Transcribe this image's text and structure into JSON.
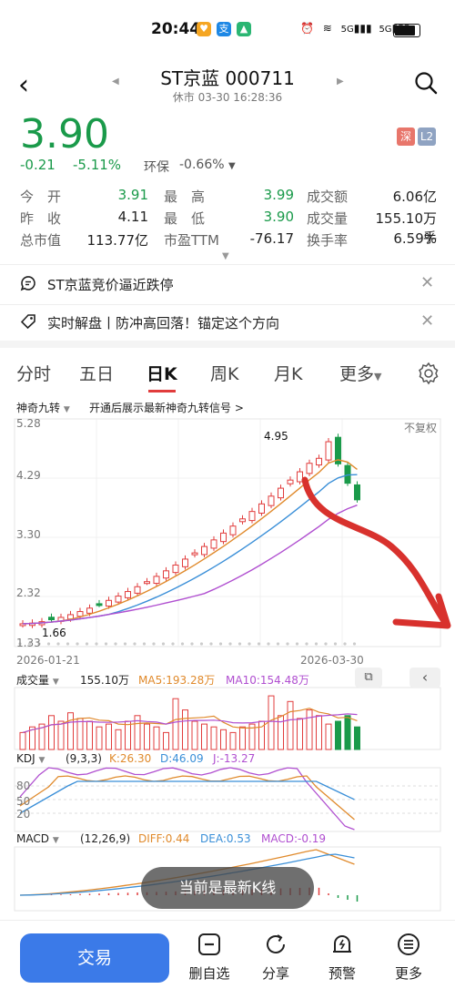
{
  "status": {
    "time": "20:44",
    "signal_1": "5G",
    "signal_2": "5G",
    "battery": "100"
  },
  "header": {
    "title": "ST京蓝 000711",
    "subtitle": "休市 03-30 16:28:36"
  },
  "quote": {
    "price": "3.90",
    "change": "-0.21",
    "change_pct": "-5.11%",
    "sector_label": "环保",
    "sector_change": "-0.66%",
    "badges": [
      "深",
      "L2"
    ],
    "rows": [
      [
        {
          "label": "今　开",
          "value": "3.91",
          "color": "#1a9a4a"
        },
        {
          "label": "最　高",
          "value": "3.99",
          "color": "#1a9a4a"
        },
        {
          "label": "成交额",
          "value": "6.06亿",
          "color": "#222"
        }
      ],
      [
        {
          "label": "昨　收",
          "value": "4.11",
          "color": "#222"
        },
        {
          "label": "最　低",
          "value": "3.90",
          "color": "#1a9a4a"
        },
        {
          "label": "成交量",
          "value": "155.10万手",
          "color": "#222"
        }
      ],
      [
        {
          "label": "总市值",
          "value": "113.77亿",
          "color": "#222"
        },
        {
          "label": "市盈TTM",
          "value": "-76.17",
          "color": "#222"
        },
        {
          "label": "换手率",
          "value": "6.59%",
          "color": "#222"
        }
      ]
    ]
  },
  "notices": [
    {
      "text": "ST京蓝竞价逼近跌停"
    },
    {
      "text": "实时解盘丨防冲高回落！锚定这个方向"
    }
  ],
  "tabs": [
    "分时",
    "五日",
    "日K",
    "周K",
    "月K",
    "更多"
  ],
  "indicator": {
    "name": "神奇九转",
    "hint": "开通后展示最新神奇九转信号 >",
    "adjust": "不复权"
  },
  "kchart": {
    "y_ticks": [
      "5.28",
      "4.29",
      "3.30",
      "2.32",
      "1.33"
    ],
    "x_start": "2026-01-21",
    "x_end": "2026-03-30",
    "high_label": "4.95",
    "low_label": "1.66"
  },
  "volume": {
    "label": "成交量",
    "value": "155.10万",
    "ma5": "MA5:193.28万",
    "ma10": "MA10:154.48万"
  },
  "kdj": {
    "label": "KDJ",
    "params": "(9,3,3)",
    "k": "K:26.30",
    "d": "D:46.09",
    "j": "J:-13.27",
    "levels": [
      "80",
      "50",
      "20"
    ]
  },
  "macd": {
    "label": "MACD",
    "params": "(12,26,9)",
    "diff": "DIFF:0.44",
    "dea": "DEA:0.53",
    "macd": "MACD:-0.19"
  },
  "toast": "当前是最新K线",
  "bottom": {
    "trade": "交易",
    "items": [
      "删自选",
      "分享",
      "预警",
      "更多"
    ]
  },
  "colors": {
    "up": "#e13c3c",
    "down": "#1a9a4a",
    "ma5": "#e08a2c",
    "ma10": "#3a8fd8",
    "ma20": "#b04fd0",
    "accent": "#3b7ae8"
  }
}
